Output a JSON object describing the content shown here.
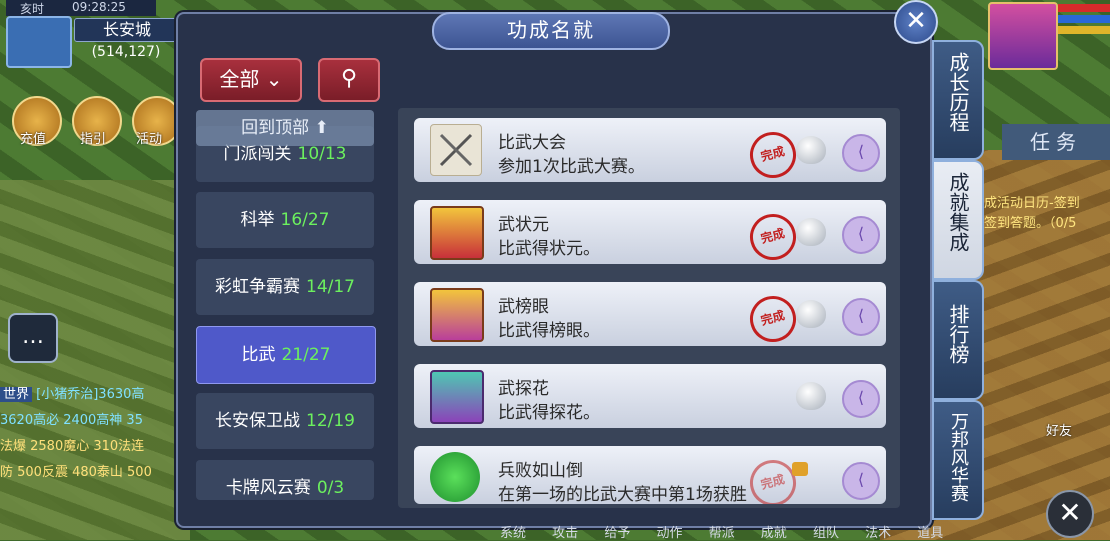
{
  "hud": {
    "time_label": "亥时",
    "clock": "09:28:25",
    "city": "长安城",
    "coords": "(514,127)",
    "buttons": [
      "充值",
      "指引",
      "活动"
    ]
  },
  "chat": {
    "channel": "世界",
    "lines": [
      "[小猪乔治]3630高",
      "3620高必 2400高神 35",
      "法爆 2580魔心 310法连",
      "防 500反震 480泰山 500"
    ]
  },
  "right": {
    "task_tab": "任务",
    "lines": [
      "成活动日历-签到",
      "签到答题。（0/5"
    ],
    "friend": "好友"
  },
  "panel": {
    "title": "功成名就",
    "filter_label": "全部",
    "back_to_top": "回到顶部",
    "categories": [
      {
        "name": "门派闯关",
        "count": "10/13"
      },
      {
        "name": "科举",
        "count": "16/27"
      },
      {
        "name": "彩虹争霸赛",
        "count": "14/17"
      },
      {
        "name": "比武",
        "count": "21/27",
        "selected": true
      },
      {
        "name": "长安保卫战",
        "count": "12/19"
      },
      {
        "name": "卡牌风云赛",
        "count": "0/3"
      }
    ],
    "achievements": [
      {
        "name": "比武大会",
        "desc": "参加1次比武大赛。",
        "icon": "crossed-swords-icon",
        "done": true
      },
      {
        "name": "武状元",
        "desc": "比武得状元。",
        "icon": "zhuangyuan-badge-icon",
        "done": true
      },
      {
        "name": "武榜眼",
        "desc": "比武得榜眼。",
        "icon": "bangyan-badge-icon",
        "done": true
      },
      {
        "name": "武探花",
        "desc": "比武得探花。",
        "icon": "tanhua-badge-icon",
        "done": false
      },
      {
        "name": "兵败如山倒",
        "desc": "在第一场的比武大赛中第1场获胜",
        "icon": "green-slime-icon",
        "done": false
      }
    ],
    "stamp_text": "完成",
    "side_tabs": [
      "成长历程",
      "成就集成",
      "排行榜",
      "万邦风华赛"
    ],
    "selected_side_tab": 1
  },
  "bottom_bar": [
    "系统",
    "攻击",
    "给予",
    "动作",
    "帮派",
    "成就",
    "组队",
    "法术",
    "道具"
  ]
}
